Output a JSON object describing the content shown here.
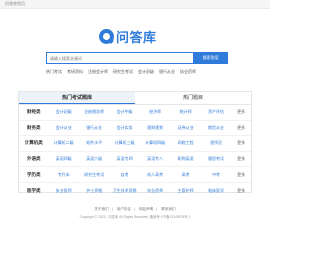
{
  "topbar": {
    "home_label": "问答库首页"
  },
  "logo": {
    "text": "问答库"
  },
  "search": {
    "placeholder": "请输入搜索关键词",
    "button_label": "搜索答案"
  },
  "hotlinks": [
    "热门考试",
    "考研资料",
    "注册会计师",
    "研究生考试",
    "会计初级",
    "银行从业",
    "执业药师"
  ],
  "panel": {
    "tabs": [
      "热门考试题库",
      "热门题目"
    ],
    "more_label": "更多",
    "rows": [
      {
        "category": "财经类",
        "items": [
          "会计初级",
          "注册税务师",
          "会计中级",
          "经济师",
          "统计师",
          "资产评估"
        ]
      },
      {
        "category": "财务类",
        "items": [
          "会计从业",
          "银行从业",
          "会计实务",
          "理财规划",
          "证券从业",
          "期货从业"
        ]
      },
      {
        "category": "计算机类",
        "items": [
          "计算机二级",
          "软件水平",
          "计算机三级",
          "计算机四级",
          "网络工程",
          "程序员"
        ]
      },
      {
        "category": "外语类",
        "items": [
          "英语四级",
          "英语六级",
          "英语专四",
          "英语专八",
          "职称英语",
          "雅思考试"
        ]
      },
      {
        "category": "学历类",
        "items": [
          "专升本",
          "研究生考试",
          "自考",
          "成人高考",
          "高考",
          "中考"
        ]
      },
      {
        "category": "医学类",
        "items": [
          "执业医师",
          "护士资格",
          "卫生技术资格",
          "执业药师",
          "主管护师",
          "临床医学"
        ]
      }
    ]
  },
  "footer": {
    "links": [
      "关于我们",
      "用户协议",
      "网站声明",
      "联系我们"
    ],
    "copyright": "Copyright © 2023 - 问答库 All Rights Reserved.  备案号 ICP备12345678号-1"
  }
}
